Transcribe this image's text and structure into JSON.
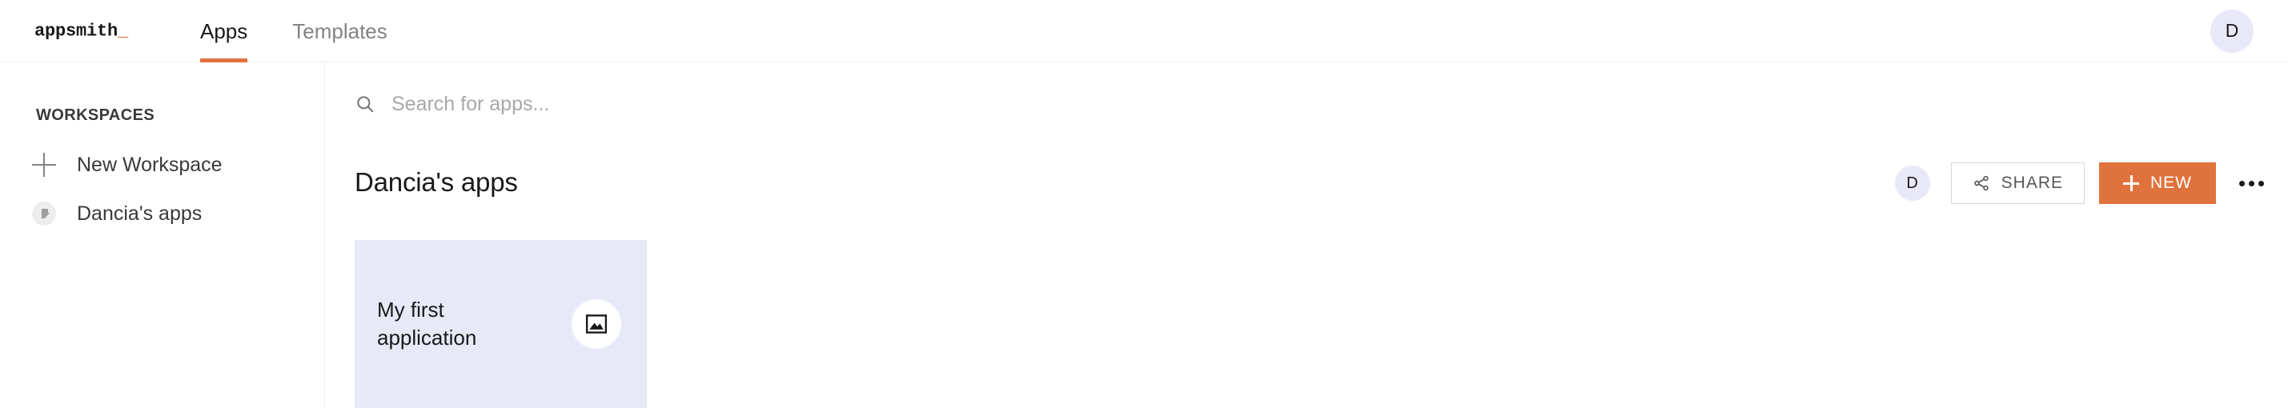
{
  "header": {
    "logo_text": "appsmith",
    "logo_cursor": "_",
    "tabs": [
      {
        "label": "Apps",
        "active": true
      },
      {
        "label": "Templates",
        "active": false
      }
    ],
    "avatar_initial": "D"
  },
  "sidebar": {
    "title": "WORKSPACES",
    "items": [
      {
        "label": "New Workspace",
        "icon": "plus-icon"
      },
      {
        "label": "Dancia's apps",
        "icon": "workspace-logo-icon"
      }
    ]
  },
  "search": {
    "placeholder": "Search for apps...",
    "value": "",
    "icon": "search-icon"
  },
  "workspace": {
    "name": "Dancia's apps",
    "member_avatar_initial": "D",
    "share_label": "SHARE",
    "share_icon": "share-icon",
    "new_label": "NEW",
    "new_icon": "plus-icon",
    "more_icon": "ellipsis-icon"
  },
  "apps": [
    {
      "name": "My first application",
      "icon": "image-placeholder-icon",
      "background": "#E7E9F7"
    }
  ],
  "colors": {
    "accent": "#E0733D",
    "card_bg": "#E7E9F7",
    "avatar_bg": "#E8E8F8",
    "text_primary": "#191919",
    "text_muted": "#858282",
    "border": "#EDEDED"
  }
}
